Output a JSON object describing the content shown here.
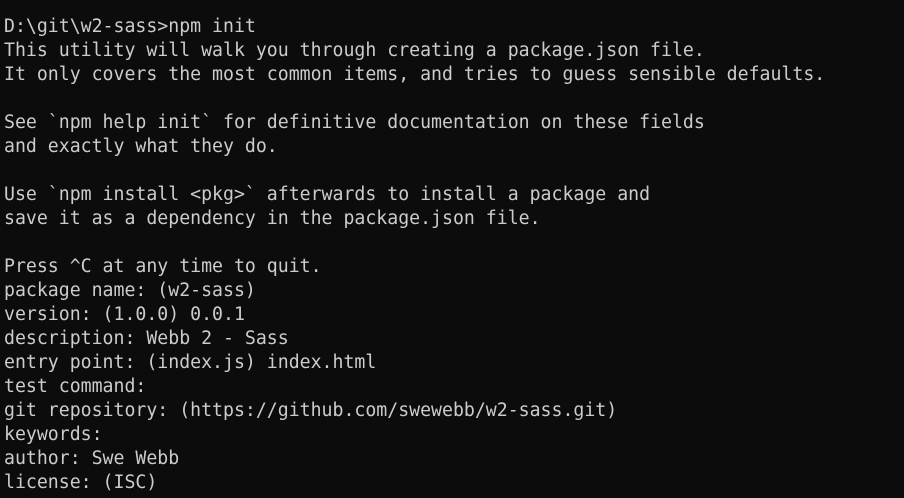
{
  "terminal": {
    "lines": [
      "D:\\git\\w2-sass>npm init",
      "This utility will walk you through creating a package.json file.",
      "It only covers the most common items, and tries to guess sensible defaults.",
      "",
      "See `npm help init` for definitive documentation on these fields",
      "and exactly what they do.",
      "",
      "Use `npm install <pkg>` afterwards to install a package and",
      "save it as a dependency in the package.json file.",
      "",
      "Press ^C at any time to quit.",
      "package name: (w2-sass)",
      "version: (1.0.0) 0.0.1",
      "description: Webb 2 - Sass",
      "entry point: (index.js) index.html",
      "test command:",
      "git repository: (https://github.com/swewebb/w2-sass.git)",
      "keywords:",
      "author: Swe Webb",
      "license: (ISC)"
    ]
  },
  "colors": {
    "background": "#0c0c0c",
    "foreground": "#cccccc"
  }
}
